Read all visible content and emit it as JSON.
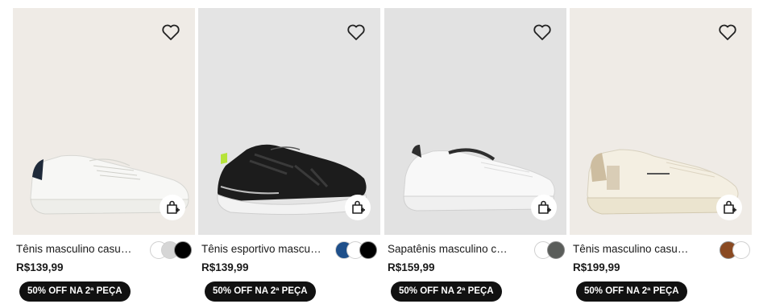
{
  "products": [
    {
      "title": "Tênis masculino casual...",
      "price": "R$139,99",
      "badge": "50% OFF NA 2ª PEÇA",
      "swatches": [
        "#ffffff",
        "#d6d6d6",
        "#000000"
      ],
      "selected_swatch": 2,
      "background": "#efebe6"
    },
    {
      "title": "Tênis esportivo masculin...",
      "price": "R$139,99",
      "badge": "50% OFF NA 2ª PEÇA",
      "swatches": [
        "#1e4f8a",
        "#ffffff",
        "#000000"
      ],
      "selected_swatch": 2,
      "background": "#e4e4e4"
    },
    {
      "title": "Sapatênis masculino casual...",
      "price": "R$159,99",
      "badge": "50% OFF NA 2ª PEÇA",
      "swatches": [
        "#ffffff",
        "#5a5d5a"
      ],
      "selected_swatch": 1,
      "background": "#e2e2e2"
    },
    {
      "title": "Tênis masculino casual com...",
      "price": "R$199,99",
      "badge": "50% OFF NA 2ª PEÇA",
      "swatches": [
        "#8a4a22",
        "#ffffff"
      ],
      "selected_swatch": 0,
      "background": "#efebe6"
    }
  ],
  "icons": {
    "favorite": "heart-icon",
    "add_to_bag": "shopping-bag-plus-icon"
  }
}
